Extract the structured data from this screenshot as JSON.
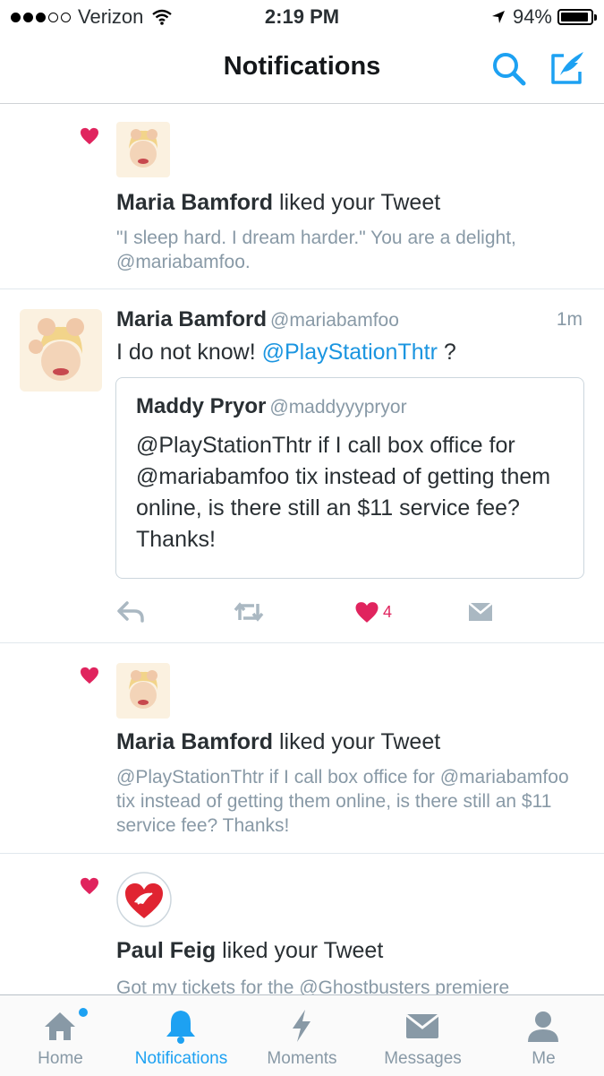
{
  "status_bar": {
    "carrier": "Verizon",
    "time": "2:19 PM",
    "battery": "94%",
    "battery_level": 0.94,
    "signal_bars": 3,
    "signal_total": 5
  },
  "header": {
    "title": "Notifications",
    "search_icon": "search-icon",
    "compose_icon": "compose-tweet-icon"
  },
  "notifications": [
    {
      "type": "like",
      "actor": "Maria Bamford",
      "action": " liked your Tweet",
      "preview": "\"I sleep hard. I dream harder.\" You are a delight, @mariabamfoo."
    },
    {
      "type": "mention",
      "name": "Maria Bamford",
      "handle": "@mariabamfoo",
      "time": "1m",
      "text_before": "I do not know! ",
      "text_mention": "@PlayStationThtr",
      "text_after": " ?",
      "quote": {
        "name": "Maddy Pryor",
        "handle": "@maddyyypryor",
        "text": "@PlayStationThtr if I call box office for @mariabamfoo tix instead of getting them online, is there still an $11 service fee? Thanks!"
      },
      "like_count": "4"
    },
    {
      "type": "like",
      "actor": "Maria Bamford",
      "action": " liked your Tweet",
      "preview": "@PlayStationThtr if I call box office for @mariabamfoo tix instead of getting them online, is there still an $11 service fee? Thanks!"
    },
    {
      "type": "like",
      "actor": "Paul Feig",
      "action": " liked your Tweet",
      "preview": "Got my tickets for the @Ghostbusters premiere"
    }
  ],
  "tabs": [
    {
      "label": "Home",
      "icon": "home-icon"
    },
    {
      "label": "Notifications",
      "icon": "bell-icon"
    },
    {
      "label": "Moments",
      "icon": "lightning-icon"
    },
    {
      "label": "Messages",
      "icon": "envelope-icon"
    },
    {
      "label": "Me",
      "icon": "person-icon"
    }
  ],
  "colors": {
    "accent": "#1da1f2",
    "like": "#e0245e",
    "muted": "#8899a6"
  }
}
